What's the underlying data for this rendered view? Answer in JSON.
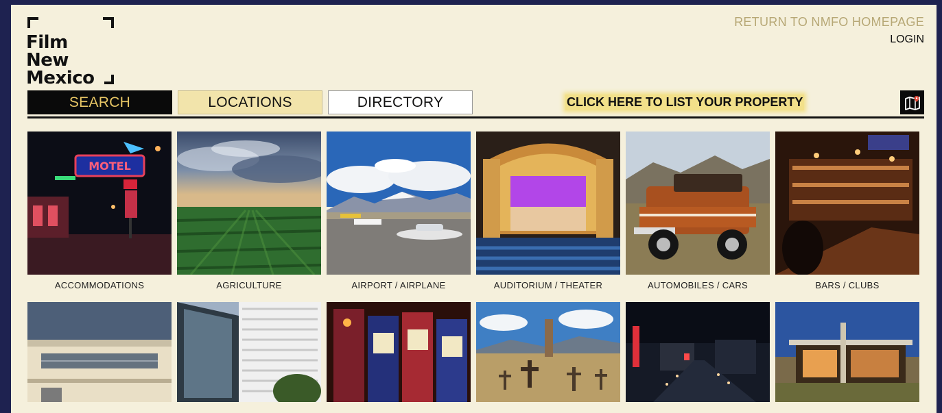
{
  "logo": {
    "line1": "Film",
    "line2": "New",
    "line3": "Mexico"
  },
  "header": {
    "return_link": "RETURN TO NMFO HOMEPAGE",
    "login_link": "LOGIN"
  },
  "nav": {
    "tabs": [
      {
        "label": "SEARCH",
        "state": "active"
      },
      {
        "label": "LOCATIONS",
        "state": "selected"
      },
      {
        "label": "DIRECTORY",
        "state": "default"
      }
    ],
    "list_property": "CLICK HERE TO LIST YOUR PROPERTY",
    "map_icon": "map-pin-icon"
  },
  "categories": [
    {
      "label": "ACCOMMODATIONS",
      "image": "motel neon sign at night",
      "sign_text": "MOTEL"
    },
    {
      "label": "AGRICULTURE",
      "image": "green crop field under stormy sky"
    },
    {
      "label": "AIRPORT / AIRPLANE",
      "image": "small airplanes on tarmac with mountains"
    },
    {
      "label": "AUDITORIUM / THEATER",
      "image": "ornate theater stage with purple backdrop"
    },
    {
      "label": "AUTOMOBILES / CARS",
      "image": "orange vintage SUV in desert"
    },
    {
      "label": "BARS / CLUBS",
      "image": "dim bar interior"
    },
    {
      "label": "",
      "image": "art deco building"
    },
    {
      "label": "",
      "image": "modern glass office building"
    },
    {
      "label": "",
      "image": "casino slot machines"
    },
    {
      "label": "",
      "image": "old cemetery with wooden crosses"
    },
    {
      "label": "",
      "image": "city street at night with neon sign"
    },
    {
      "label": "",
      "image": "modern house at dusk"
    }
  ],
  "colors": {
    "background": "#1e2250",
    "page": "#f5f0dc",
    "search_tab_bg": "#0a0a0a",
    "search_tab_text": "#e8c665",
    "locations_tab_bg": "#f2e4ab",
    "highlight": "#f2e08a",
    "return_link": "#b7a876"
  }
}
